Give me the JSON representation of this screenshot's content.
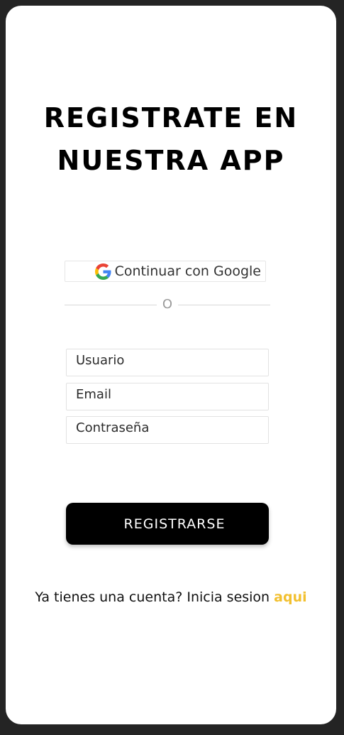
{
  "page": {
    "title_line1": "REGISTRATE EN",
    "title_line2": "NUESTRA APP"
  },
  "google": {
    "label": "Continuar con Google",
    "icon": "google-icon"
  },
  "divider": {
    "text": "O"
  },
  "form": {
    "username_placeholder": "Usuario",
    "email_placeholder": "Email",
    "password_placeholder": "Contraseña",
    "submit_label": "REGISTRARSE"
  },
  "footer": {
    "prompt": "Ya tienes una cuenta? Inicia sesion ",
    "link_label": "aqui"
  },
  "colors": {
    "background": "#242424",
    "card": "#ffffff",
    "button": "#000000",
    "link": "#f2c030"
  }
}
